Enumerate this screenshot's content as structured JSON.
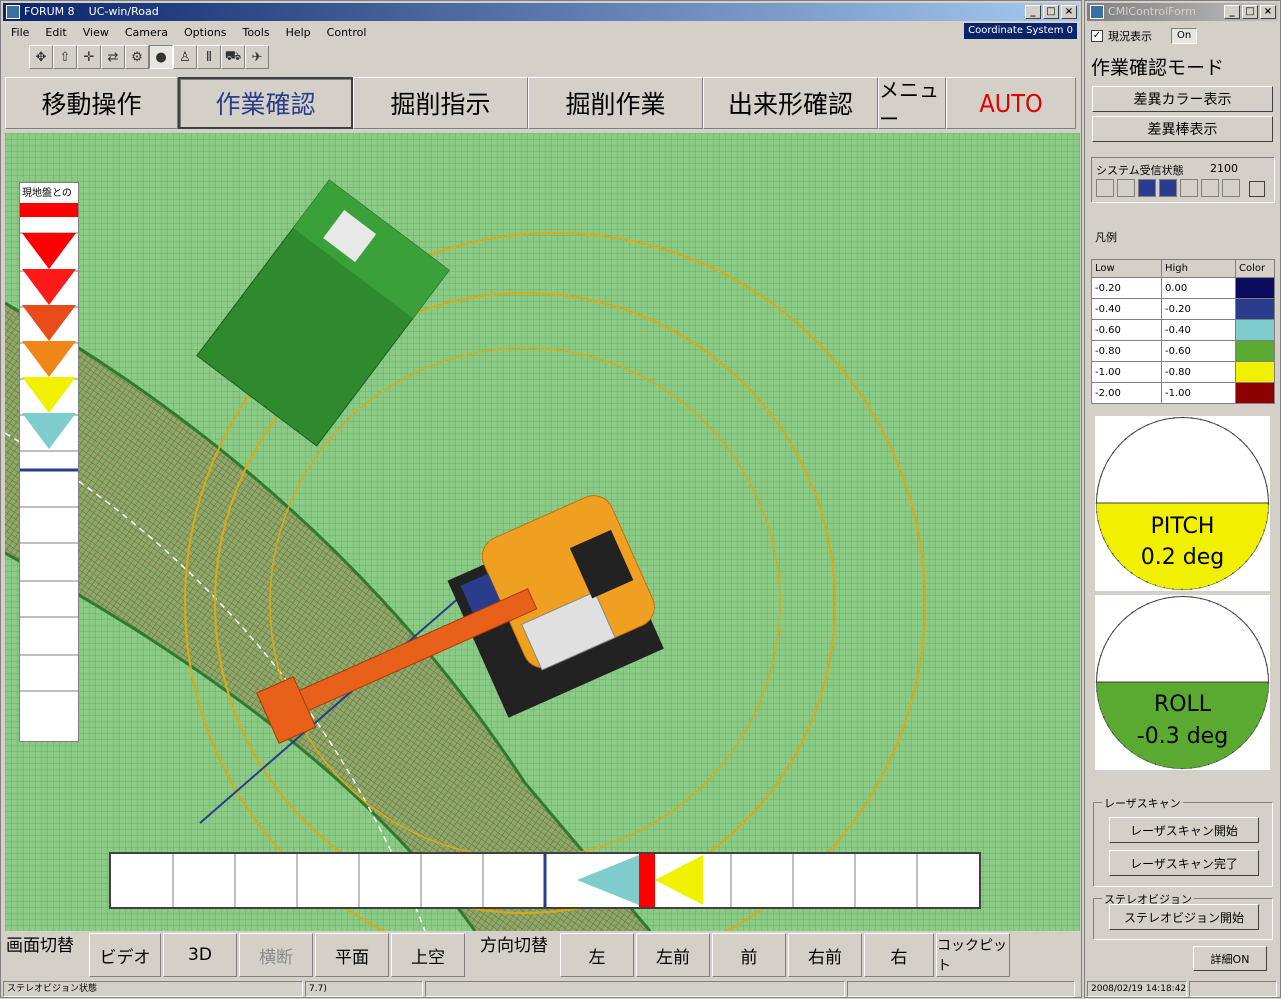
{
  "main_window": {
    "title": "FORUM 8    UC-win/Road",
    "menus": [
      "File",
      "Edit",
      "View",
      "Camera",
      "Options",
      "Tools",
      "Help",
      "Control"
    ],
    "coordinate_label": "Coordinate System 0",
    "toolbar_icons": [
      "rotate-icon",
      "up-arrow-icon",
      "move-icon",
      "fly-icon",
      "drive-icon",
      "globe-icon",
      "person-icon",
      "pause-icon",
      "car-icon",
      "plane-icon"
    ],
    "mode_tabs": [
      "移動操作",
      "作業確認",
      "掘削指示",
      "掘削作業",
      "出来形確認",
      "メニュー",
      "AUTO"
    ],
    "active_tab": "作業確認"
  },
  "depth_gauge": {
    "title": "現地盤との",
    "marker_colors": [
      "#ff0000",
      "#ff1a1a",
      "#ff3300",
      "#e84c1a",
      "#f0861a",
      "#f0f000",
      "#7fcccc"
    ]
  },
  "horizontal_gauge": {
    "marker_colors": [
      "#7fcccc",
      "#ff0000",
      "#f0f000"
    ]
  },
  "bottom_bar": {
    "screen_switch_label": "画面切替",
    "screen_buttons": [
      "ビデオ",
      "3D",
      "横断",
      "平面",
      "上空"
    ],
    "direction_label": "方向切替",
    "direction_buttons": [
      "左",
      "左前",
      "前",
      "右前",
      "右",
      "コックピット"
    ]
  },
  "status_bar": {
    "panels": [
      "ステレオビジョン状態",
      "7.7)",
      "",
      ""
    ]
  },
  "side_window": {
    "title": "CMIControlForm",
    "current_display_label": "現況表示",
    "current_display_checked": true,
    "on_label": "On",
    "mode_title": "作業確認モード",
    "diff_color_button": "差異カラー表示",
    "diff_bar_button": "差異棒表示",
    "system_status_label": "システム受信状態",
    "system_status_value": "2100",
    "system_cells_on": [
      false,
      false,
      true,
      true,
      false,
      false,
      false
    ],
    "legend_label": "凡例",
    "legend_headers": [
      "Low",
      "High",
      "Color"
    ],
    "legend_rows": [
      {
        "low": "-0.20",
        "high": "0.00",
        "color": "#0c0c5e"
      },
      {
        "low": "-0.40",
        "high": "-0.20",
        "color": "#2a3c8c"
      },
      {
        "low": "-0.60",
        "high": "-0.40",
        "color": "#7fcccc"
      },
      {
        "low": "-0.80",
        "high": "-0.60",
        "color": "#5aaa32"
      },
      {
        "low": "-1.00",
        "high": "-0.80",
        "color": "#f0f000"
      },
      {
        "low": "-2.00",
        "high": "-1.00",
        "color": "#8c0000"
      }
    ],
    "pitch": {
      "label": "PITCH",
      "value": "0.2 deg",
      "fill": "#f0f000",
      "level": 0.5
    },
    "roll": {
      "label": "ROLL",
      "value": "-0.3 deg",
      "fill": "#5aaa32",
      "level": 0.5
    },
    "laser_group": "レーザスキャン",
    "laser_start": "レーザスキャン開始",
    "laser_end": "レーザスキャン完了",
    "stereo_group": "ステレオビジョン",
    "stereo_start": "ステレオビジョン開始",
    "detail_button": "詳細ON",
    "timestamp": "2008/02/19 14:18:42"
  }
}
